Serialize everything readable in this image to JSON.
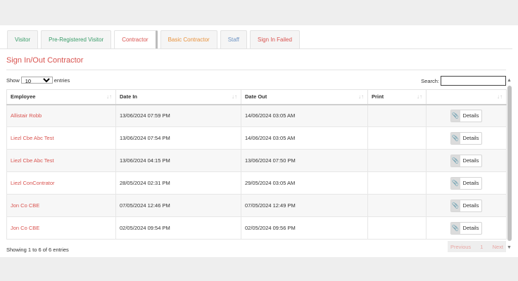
{
  "tabs": [
    {
      "label": "Visitor",
      "color": "#3a9d6a"
    },
    {
      "label": "Pre-Registered Visitor",
      "color": "#3a9d6a"
    },
    {
      "label": "Contractor",
      "color": "#d9534f"
    },
    {
      "label": "Basic Contractor",
      "color": "#e8913a"
    },
    {
      "label": "Staff",
      "color": "#6f95c4"
    },
    {
      "label": "Sign In Failed",
      "color": "#d9534f"
    }
  ],
  "active_tab": "Contractor",
  "section_title": "Sign In/Out Contractor",
  "length": {
    "show_label": "Show",
    "selected": "10",
    "entries_label": "entries"
  },
  "search": {
    "label": "Search:",
    "value": ""
  },
  "table": {
    "headers": [
      "Employee",
      "Date In",
      "Date Out",
      "Print",
      ""
    ],
    "rows": [
      {
        "employee": "Allistair Robb",
        "date_in": "13/06/2024 07:59 PM",
        "date_out": "14/06/2024 03:05 AM",
        "print": "",
        "action": "Details"
      },
      {
        "employee": "Liezl Cbe Abc Test",
        "date_in": "13/06/2024 07:54 PM",
        "date_out": "14/06/2024 03:05 AM",
        "print": "",
        "action": "Details"
      },
      {
        "employee": "Liezl Cbe Abc Test",
        "date_in": "13/06/2024 04:15 PM",
        "date_out": "13/06/2024 07:50 PM",
        "print": "",
        "action": "Details"
      },
      {
        "employee": "Liezl ConContrator",
        "date_in": "28/05/2024 02:31 PM",
        "date_out": "29/05/2024 03:05 AM",
        "print": "",
        "action": "Details"
      },
      {
        "employee": "Jon Co CBE",
        "date_in": "07/05/2024 12:46 PM",
        "date_out": "07/05/2024 12:49 PM",
        "print": "",
        "action": "Details"
      },
      {
        "employee": "Jon Co CBE",
        "date_in": "02/05/2024 09:54 PM",
        "date_out": "02/05/2024 09:56 PM",
        "print": "",
        "action": "Details"
      }
    ]
  },
  "info": "Showing 1 to 6 of 6 entries",
  "pager": {
    "previous": "Previous",
    "page": "1",
    "next": "Next"
  },
  "icons": {
    "details": "paperclip-icon",
    "sort": "sort-arrows-icon"
  }
}
